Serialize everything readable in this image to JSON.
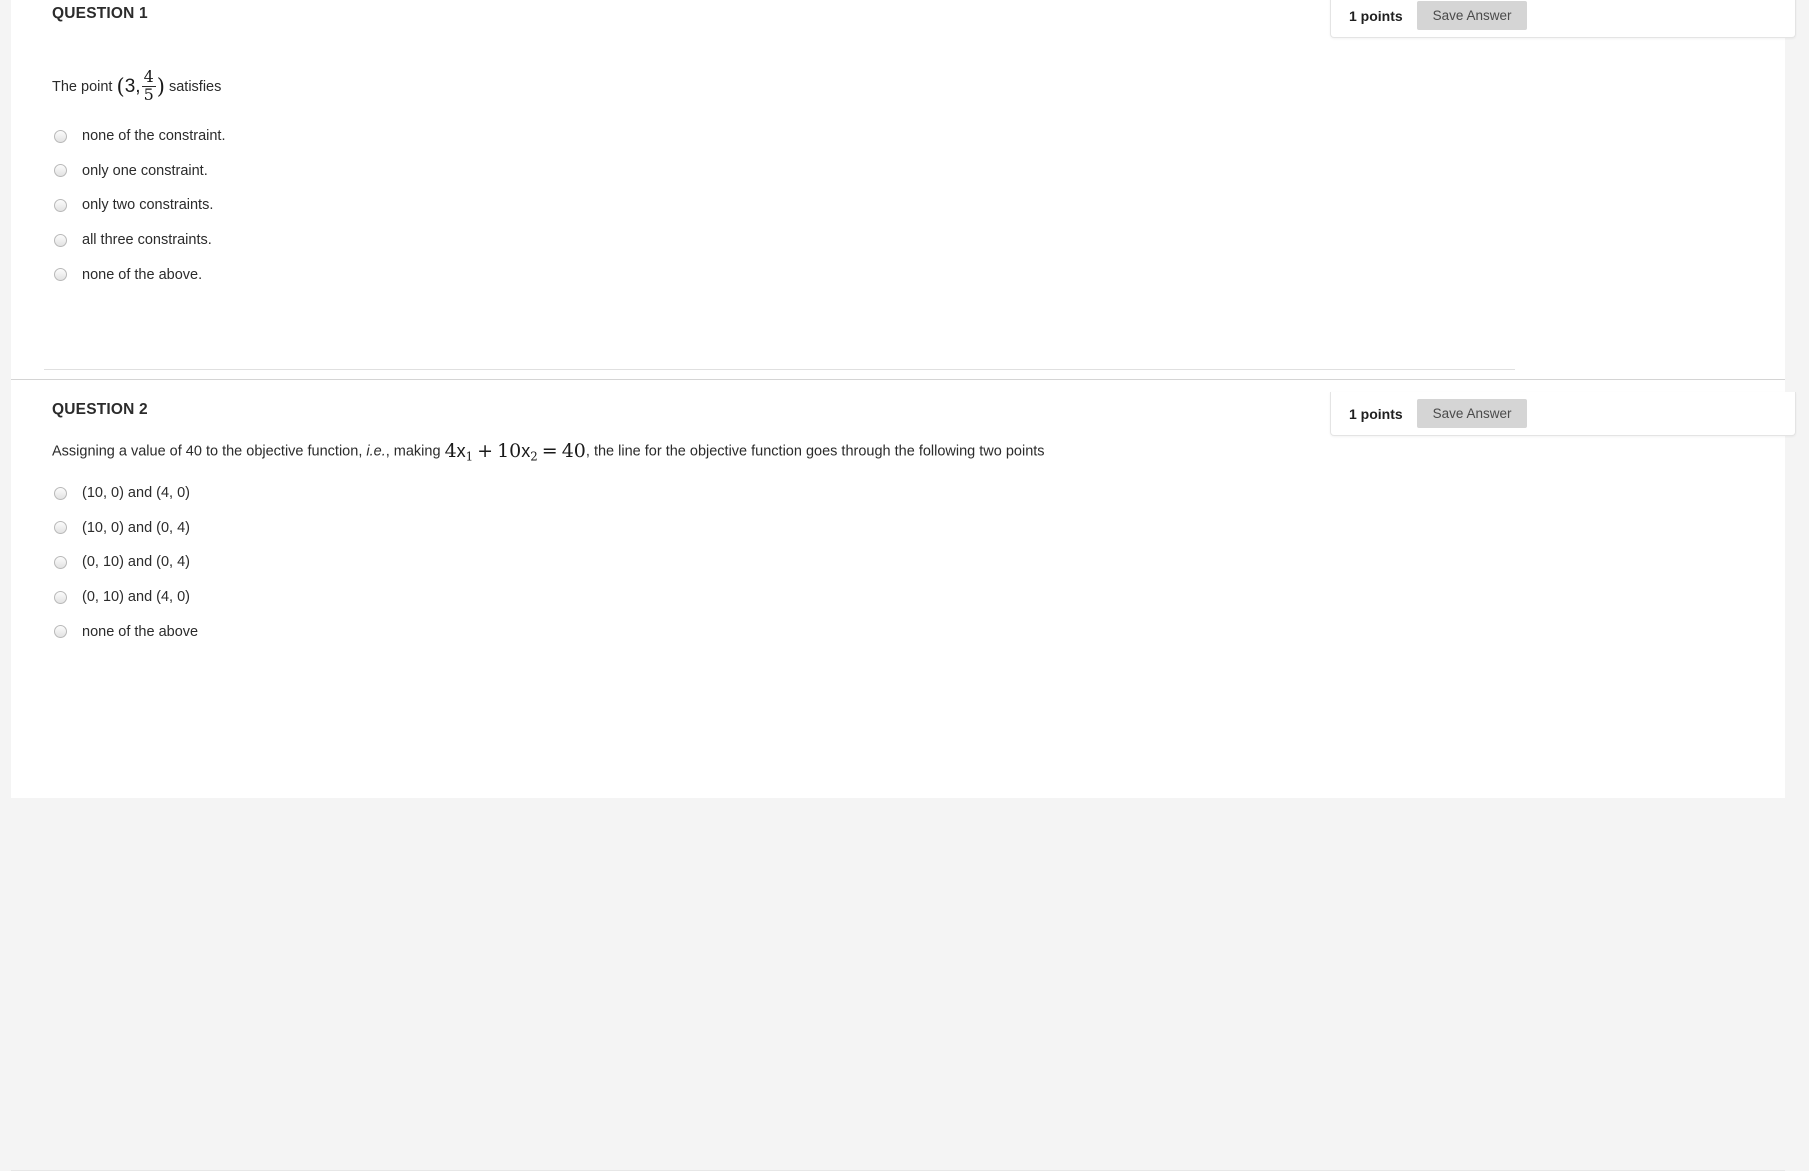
{
  "questions": [
    {
      "heading": "QUESTION 1",
      "points_label": "1 points",
      "save_label": "Save Answer",
      "body": {
        "lead": "The point",
        "open_paren": "(",
        "first_coord": "3,",
        "frac_numerator": "4",
        "frac_denominator": "5",
        "close_paren": ")",
        "trail": "satisfies"
      },
      "options": [
        "none of the constraint.",
        "only one constraint.",
        "only two constraints.",
        "all three constraints.",
        "none of the above."
      ]
    },
    {
      "heading": "QUESTION 2",
      "points_label": "1 points",
      "save_label": "Save Answer",
      "body": {
        "lead": "Assigning a value of 40 to the objective function,",
        "italic": "i.e.",
        "mid": ", making",
        "eq_coef1": "4",
        "eq_var1": "x",
        "eq_sub1": "1",
        "eq_plus": "+",
        "eq_coef2": "10",
        "eq_var2": "x",
        "eq_sub2": "2",
        "eq_equals": "=",
        "eq_rhs": "40",
        "trail": ", the line for the objective function goes through the following two points"
      },
      "options": [
        "(10, 0) and (4, 0)",
        "(10, 0) and (0, 4)",
        "(0, 10) and (0, 4)",
        "(0, 10) and (4, 0)",
        "none of the above"
      ]
    }
  ]
}
